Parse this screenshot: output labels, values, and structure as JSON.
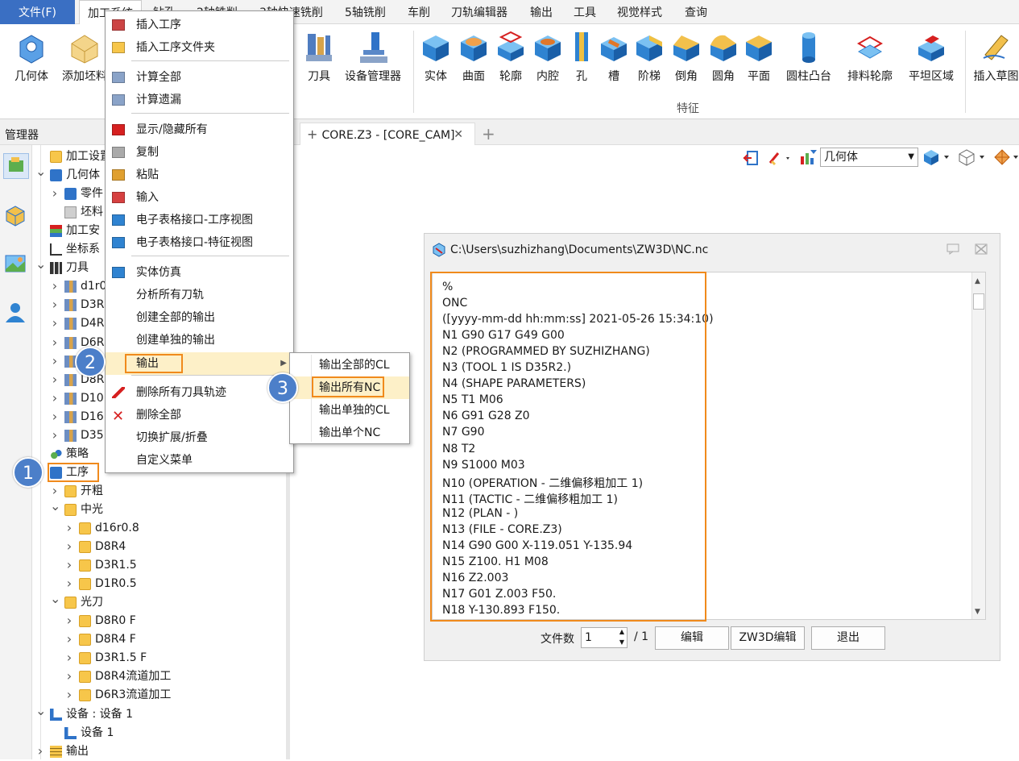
{
  "menubar": {
    "file": "文件(F)",
    "tabs": [
      "加工系统",
      "钻孔",
      "2轴铣削",
      "3轴快速铣削",
      "5轴铣削",
      "车削",
      "刀轨编辑器",
      "输出",
      "工具",
      "视觉样式",
      "查询"
    ]
  },
  "ribbon": {
    "left_buttons": [
      {
        "label": "几何体",
        "icon": "geometry-icon"
      },
      {
        "label": "添加坯料",
        "icon": "add-stock-icon"
      }
    ],
    "tool_buttons": [
      {
        "label": "刀具",
        "icon": "tool-icon"
      },
      {
        "label": "设备管理器",
        "icon": "machine-manager-icon"
      }
    ],
    "feature_buttons": [
      {
        "label": "实体",
        "icon": "solid-icon"
      },
      {
        "label": "曲面",
        "icon": "surface-icon"
      },
      {
        "label": "轮廓",
        "icon": "profile-icon"
      },
      {
        "label": "内腔",
        "icon": "pocket-icon"
      },
      {
        "label": "孔",
        "icon": "hole-icon"
      },
      {
        "label": "槽",
        "icon": "slot-icon"
      },
      {
        "label": "阶梯",
        "icon": "step-icon"
      },
      {
        "label": "倒角",
        "icon": "chamfer-icon"
      },
      {
        "label": "圆角",
        "icon": "fillet-icon"
      },
      {
        "label": "平面",
        "icon": "plane-icon"
      },
      {
        "label": "圆柱凸台",
        "icon": "cylinder-boss-icon"
      },
      {
        "label": "排料轮廓",
        "icon": "nesting-profile-icon"
      },
      {
        "label": "平坦区域",
        "icon": "flat-area-icon"
      }
    ],
    "feature_group_label": "特征",
    "sketch_button": "插入草图"
  },
  "manager": {
    "title": "管理器"
  },
  "tree": [
    {
      "label": "加工设置",
      "indent": 0,
      "chev": "",
      "icon": "folder"
    },
    {
      "label": "几何体",
      "indent": 0,
      "chev": "v",
      "icon": "cube"
    },
    {
      "label": "零件",
      "indent": 1,
      "chev": ">",
      "icon": "cube"
    },
    {
      "label": "坯料",
      "indent": 1,
      "chev": "",
      "icon": "stock"
    },
    {
      "label": "加工安",
      "indent": 0,
      "chev": "",
      "icon": "layers"
    },
    {
      "label": "坐标系",
      "indent": 0,
      "chev": "",
      "icon": "axes"
    },
    {
      "label": "刀具",
      "indent": 0,
      "chev": "v",
      "icon": "toolset"
    },
    {
      "label": "d1r0",
      "indent": 1,
      "chev": ">",
      "icon": "tool"
    },
    {
      "label": "D3R",
      "indent": 1,
      "chev": ">",
      "icon": "tool"
    },
    {
      "label": "D4R",
      "indent": 1,
      "chev": ">",
      "icon": "tool"
    },
    {
      "label": "D6R",
      "indent": 1,
      "chev": ">",
      "icon": "tool"
    },
    {
      "label": "D8R",
      "indent": 1,
      "chev": ">",
      "icon": "tool"
    },
    {
      "label": "D8R",
      "indent": 1,
      "chev": ">",
      "icon": "tool"
    },
    {
      "label": "D10",
      "indent": 1,
      "chev": ">",
      "icon": "tool"
    },
    {
      "label": "D16",
      "indent": 1,
      "chev": ">",
      "icon": "tool"
    },
    {
      "label": "D35",
      "indent": 1,
      "chev": ">",
      "icon": "tool"
    },
    {
      "label": "策略",
      "indent": 0,
      "chev": "",
      "icon": "gears"
    },
    {
      "label": "工序",
      "indent": 0,
      "chev": "",
      "icon": "cube"
    },
    {
      "label": "开粗",
      "indent": 1,
      "chev": ">",
      "icon": "folder"
    },
    {
      "label": "中光",
      "indent": 1,
      "chev": "v",
      "icon": "folder"
    },
    {
      "label": "d16r0.8",
      "indent": 2,
      "chev": ">",
      "icon": "folder"
    },
    {
      "label": "D8R4",
      "indent": 2,
      "chev": ">",
      "icon": "folder"
    },
    {
      "label": "D3R1.5",
      "indent": 2,
      "chev": ">",
      "icon": "folder"
    },
    {
      "label": "D1R0.5",
      "indent": 2,
      "chev": ">",
      "icon": "folder"
    },
    {
      "label": "光刀",
      "indent": 1,
      "chev": "v",
      "icon": "folder"
    },
    {
      "label": "D8R0 F",
      "indent": 2,
      "chev": ">",
      "icon": "folder"
    },
    {
      "label": "D8R4 F",
      "indent": 2,
      "chev": ">",
      "icon": "folder"
    },
    {
      "label": "D3R1.5 F",
      "indent": 2,
      "chev": ">",
      "icon": "folder"
    },
    {
      "label": "D8R4流道加工",
      "indent": 2,
      "chev": ">",
      "icon": "folder"
    },
    {
      "label": "D6R3流道加工",
      "indent": 2,
      "chev": ">",
      "icon": "folder"
    },
    {
      "label": "设备 : 设备 1",
      "indent": 0,
      "chev": "v",
      "icon": "machine"
    },
    {
      "label": "设备 1",
      "indent": 1,
      "chev": "",
      "icon": "machine"
    },
    {
      "label": "输出",
      "indent": 0,
      "chev": ">",
      "icon": "output"
    }
  ],
  "doc_tab": {
    "label": "CORE.Z3 - [CORE_CAM]",
    "close": "✕",
    "plus": "+"
  },
  "viewport_toolbar": {
    "combo": "几何体"
  },
  "context_menu": {
    "items": [
      "插入工序",
      "插入工序文件夹",
      "计算全部",
      "计算遗漏",
      "显示/隐藏所有",
      "复制",
      "粘贴",
      "输入",
      "电子表格接口-工序视图",
      "电子表格接口-特征视图",
      "实体仿真",
      "分析所有刀轨",
      "创建全部的输出",
      "创建单独的输出",
      "输出",
      "删除所有刀具轨迹",
      "删除全部",
      "切换扩展/折叠",
      "自定义菜单"
    ]
  },
  "submenu": {
    "items": [
      "输出全部的CL",
      "输出所有NC",
      "输出单独的CL",
      "输出单个NC"
    ]
  },
  "badges": [
    "1",
    "2",
    "3"
  ],
  "nc_window": {
    "title": "C:\\Users\\suzhizhang\\Documents\\ZW3D\\NC.nc",
    "lines": [
      "%",
      "ONC",
      "([yyyy-mm-dd hh:mm:ss] 2021-05-26 15:34:10)",
      "N1 G90 G17 G49 G00",
      "N2 (PROGRAMMED BY SUZHIZHANG)",
      "N3 (TOOL 1 IS D35R2.)",
      "N4 (SHAPE PARAMETERS)",
      "N5 T1 M06",
      "N6 G91 G28 Z0",
      "N7 G90",
      "N8 T2",
      "N9 S1000 M03",
      "N10 (OPERATION - 二维偏移粗加工 1)",
      "N11 (TACTIC - 二维偏移粗加工 1)",
      "N12 (PLAN - )",
      "N13 (FILE - CORE.Z3)",
      "N14 G90 G00 X-119.051 Y-135.94",
      "N15 Z100. H1 M08",
      "N16 Z2.003",
      "N17 G01 Z.003 F50.",
      "N18 Y-130.893 F150."
    ],
    "file_count_label": "文件数",
    "file_count_value": "1",
    "file_total": "/ 1",
    "buttons": [
      "编辑",
      "ZW3D编辑",
      "退出"
    ]
  },
  "colors": {
    "accent": "#3a6fc3",
    "highlight": "#f08a1c",
    "badge": "#4c7fc9",
    "menu_hover": "#fdf0c8"
  }
}
